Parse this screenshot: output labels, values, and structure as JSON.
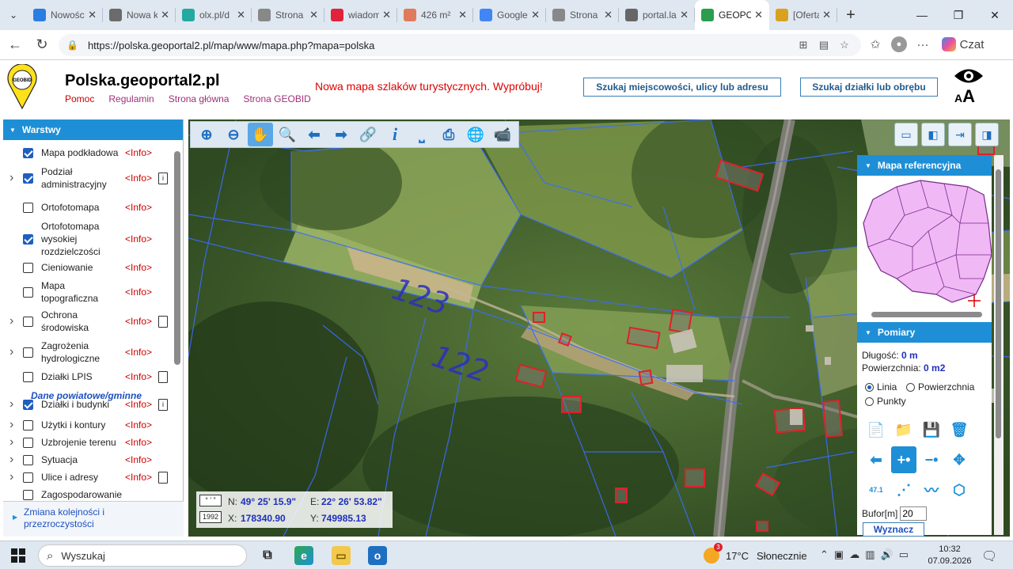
{
  "browser": {
    "tabs": [
      {
        "title": "Nowości",
        "icon": "edge-icon",
        "color": "#2a7de1",
        "active": false
      },
      {
        "title": "Nowa ka",
        "icon": "newtab-icon",
        "color": "#6b6b6b",
        "active": false
      },
      {
        "title": "olx.pl/d",
        "icon": "olx-icon",
        "color": "#23a9a0",
        "active": false
      },
      {
        "title": "Strona W",
        "icon": "page-icon",
        "color": "#888888",
        "active": false
      },
      {
        "title": "wiadom",
        "icon": "wp-icon",
        "color": "#e0223b",
        "active": false
      },
      {
        "title": "426 m²",
        "icon": "house-icon",
        "color": "#e07a5a",
        "active": false
      },
      {
        "title": "Google",
        "icon": "google-icon",
        "color": "#4285f4",
        "active": false
      },
      {
        "title": "Strona W",
        "icon": "page-icon",
        "color": "#888888",
        "active": false
      },
      {
        "title": "portal.la",
        "icon": "globe-icon",
        "color": "#666666",
        "active": false
      },
      {
        "title": "GEOPOR",
        "icon": "geoportal-icon",
        "color": "#2a9d4f",
        "active": true
      },
      {
        "title": "[Oferta]",
        "icon": "offer-icon",
        "color": "#d9a21e",
        "active": false
      }
    ],
    "url": "https://polska.geoportal2.pl/map/www/mapa.php?mapa=polska",
    "copilot_label": "Czat"
  },
  "site": {
    "title": "Polska.geoportal2.pl",
    "logo_text": "GEOBID",
    "links": [
      "Pomoc",
      "Regulamin",
      "Strona główna",
      "Strona GEOBID"
    ],
    "promo": "Nowa mapa szlaków turystycznych. Wypróbuj!",
    "search_address": "Szukaj miejscowości, ulicy lub adresu",
    "search_parcel": "Szukaj działki lub obrębu",
    "font_toggle_small": "A",
    "font_toggle_big": "A"
  },
  "layers_panel": {
    "title": "Warstwy",
    "layers": [
      {
        "name": "Mapa podkładowa",
        "checked": true,
        "expand": false,
        "info": "<Info>",
        "doc": ""
      },
      {
        "name": "Podział administracyjny",
        "checked": true,
        "expand": true,
        "info": "<Info>",
        "doc": "i"
      },
      {
        "name": "Ortofotomapa",
        "checked": false,
        "expand": false,
        "info": "<Info>",
        "doc": ""
      },
      {
        "name": "Ortofotomapa wysokiej rozdzielczości",
        "checked": true,
        "expand": false,
        "info": "<Info>",
        "doc": ""
      },
      {
        "name": "Cieniowanie",
        "checked": false,
        "expand": false,
        "info": "<Info>",
        "doc": ""
      },
      {
        "name": "Mapa topograficzna",
        "checked": false,
        "expand": false,
        "info": "<Info>",
        "doc": ""
      },
      {
        "name": "Ochrona środowiska",
        "checked": false,
        "expand": true,
        "info": "<Info>",
        "doc": " "
      },
      {
        "name": "Zagrożenia hydrologiczne",
        "checked": false,
        "expand": true,
        "info": "<Info>",
        "doc": ""
      },
      {
        "name": "Działki LPIS",
        "checked": false,
        "expand": false,
        "info": "<Info>",
        "doc": " "
      },
      {
        "name": "Działki i budynki",
        "checked": true,
        "expand": true,
        "info": "<Info>",
        "doc": "i"
      },
      {
        "name": "Użytki i kontury",
        "checked": false,
        "expand": true,
        "info": "<Info>",
        "doc": ""
      },
      {
        "name": "Uzbrojenie terenu",
        "checked": false,
        "expand": true,
        "info": "<Info>",
        "doc": ""
      },
      {
        "name": "Sytuacja",
        "checked": false,
        "expand": true,
        "info": "<Info>",
        "doc": ""
      },
      {
        "name": "Ulice i adresy",
        "checked": false,
        "expand": true,
        "info": "<Info>",
        "doc": " "
      },
      {
        "name": "Zagospodarowanie",
        "checked": false,
        "expand": false,
        "info": "",
        "doc": ""
      }
    ],
    "section_label": "Dane powiatowe/gminne",
    "bottom_link": "Zmiana kolejności i przezroczystości"
  },
  "map": {
    "parcel_labels": [
      "123",
      "122"
    ],
    "coords": {
      "format_btn": "° ' \"",
      "crs_btn": "1992",
      "n_label": "N:",
      "n_value": "49° 25' 15.9\"",
      "e_label": "E:",
      "e_value": "22° 26' 53.82\"",
      "x_label": "X:",
      "x_value": "178340.90",
      "y_label": "Y:",
      "y_value": "749985.13"
    }
  },
  "right_panel": {
    "ref_title": "Mapa referencyjna",
    "measure_title": "Pomiary",
    "length_label": "Długość:",
    "length_value": "0 m",
    "area_label": "Powierzchnia:",
    "area_value": "0 m2",
    "mode_line": "Linia",
    "mode_area": "Powierzchnia",
    "mode_points": "Punkty",
    "buffer_label": "Bufor[m]",
    "buffer_value": "20",
    "compute_label": "Wyznacz",
    "measure_icon_text": "47.1"
  },
  "taskbar": {
    "search_placeholder": "Wyszukaj",
    "temperature": "17°C",
    "weather": "Słonecznie",
    "weather_badge": "3",
    "time": "10:32",
    "date": "07.09.2026"
  },
  "colors": {
    "accent": "#1e8fd7",
    "info_red": "#cc0000",
    "link_purple": "#a03078",
    "parcel_line": "#3a6cff",
    "building": "#e0202a",
    "label_blue": "#2b2fc0"
  }
}
